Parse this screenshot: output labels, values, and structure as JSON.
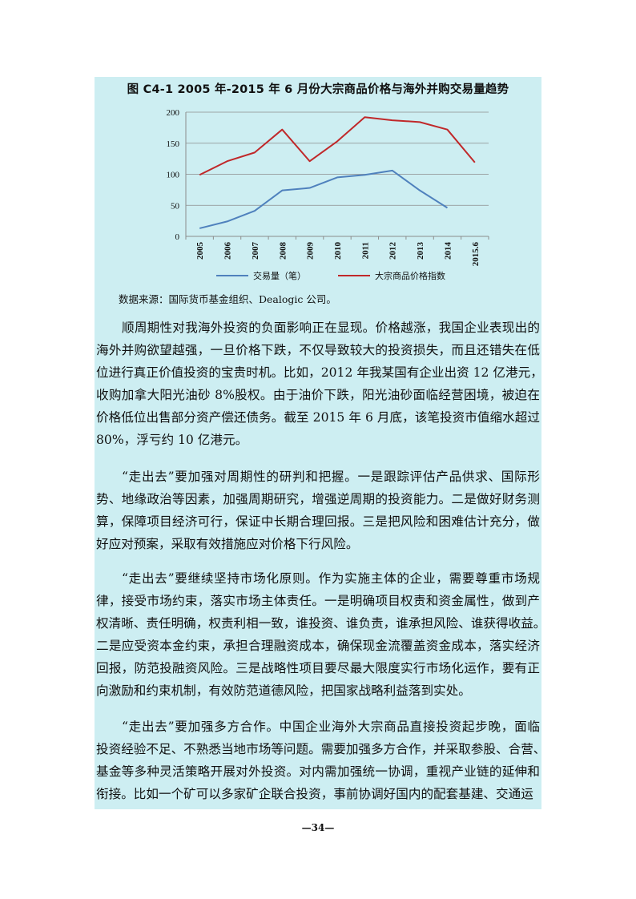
{
  "figure": {
    "title": "图 C4-1    2005 年-2015 年 6 月份大宗商品价格与海外并购交易量趋势"
  },
  "chart_data": {
    "type": "line",
    "title": "",
    "xlabel": "",
    "ylabel": "",
    "categories": [
      "2005",
      "2006",
      "2007",
      "2008",
      "2009",
      "2010",
      "2011",
      "2012",
      "2013",
      "2014",
      "2015.6"
    ],
    "ylim": [
      0,
      200
    ],
    "yticks": [
      "0",
      "50",
      "100",
      "150",
      "200"
    ],
    "grid": true,
    "legend_position": "bottom",
    "series": [
      {
        "name": "交易量（笔）",
        "color": "#4f81bd",
        "values": [
          13,
          24,
          41,
          74,
          78,
          95,
          99,
          106,
          74,
          46,
          null
        ]
      },
      {
        "name": "大宗商品价格指数",
        "color": "#c0282a",
        "values": [
          99,
          121,
          135,
          172,
          121,
          153,
          192,
          187,
          184,
          172,
          119
        ]
      }
    ]
  },
  "source_note": "数据来源：国际货币基金组织、Dealogic 公司。",
  "paragraphs": [
    {
      "top": 395,
      "lines": [
        "顺周期性对我海外投资的负面影响正在显现。价格越涨，我国企业表现出的",
        "海外并购欲望越强，一旦价格下跌，不仅导致较大的投资损失，而且还错失在低",
        "位进行真正价值投资的宝贵时机。比如，2012 年我某国有企业出资 12 亿港元，",
        "收购加拿大阳光油砂 8%股权。由于油价下跌，阳光油砂面临经营困境，被迫在",
        "价格低位出售部分资产偿还债务。截至 2015 年 6 月底，该笔投资市值缩水超过",
        "80%，浮亏约 10 亿港元。"
      ]
    },
    {
      "top": 581,
      "lines": [
        "“走出去”要加强对周期性的研判和把握。一是跟踪评估产品供求、国际形",
        "势、地缘政治等因素，加强周期研究，增强逆周期的投资能力。二是做好财务测",
        "算，保障项目经济可行，保证中长期合理回报。三是把风险和困难估计充分，做",
        "好应对预案，采取有效措施应对价格下行风险。"
      ]
    },
    {
      "top": 708,
      "lines": [
        "“走出去”要继续坚持市场化原则。作为实施主体的企业，需要尊重市场规",
        "律，接受市场约束，落实市场主体责任。一是明确项目权责和资金属性，做到产",
        "权清晰、责任明确，权责利相一致，谁投资、谁负责，谁承担风险、谁获得收益。",
        "二是应受资本金约束，承担合理融资成本，确保现金流覆盖资金成本，落实经济",
        "回报，防范投融资风险。三是战略性项目要尽最大限度实行市场化运作，要有正",
        "向激励和约束机制，有效防范道德风险，把国家战略利益落到实处。"
      ]
    },
    {
      "top": 893,
      "lines": [
        "“走出去”要加强多方合作。中国企业海外大宗商品直接投资起步晚，面临",
        "投资经验不足、不熟悉当地市场等问题。需要加强多方合作，并采取参股、合营、",
        "基金等多种灵活策略开展对外投资。对内需加强统一协调，重视产业链的延伸和",
        "衔接。比如一个矿可以多家矿企联合投资，事前协调好国内的配套基建、交通运"
      ]
    }
  ],
  "page_number": "—34—"
}
